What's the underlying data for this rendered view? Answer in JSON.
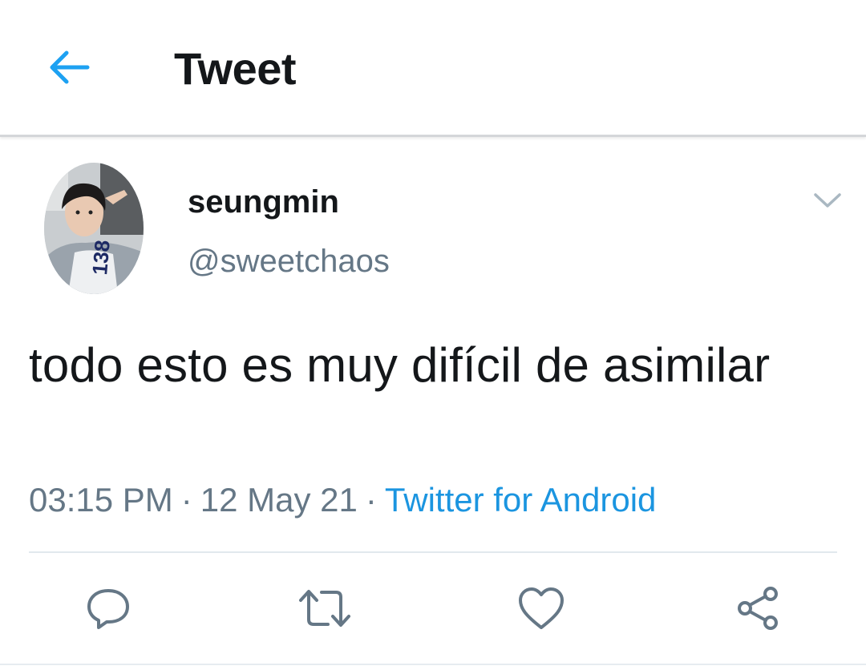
{
  "header": {
    "back_icon": "arrow-left-icon",
    "title": "Tweet",
    "accent_color": "#1da1f2"
  },
  "tweet": {
    "author_name": "seungmin",
    "author_handle": "@sweetchaos",
    "text": "todo esto es muy difícil de asimilar",
    "time": "03:15 PM",
    "separator": "·",
    "date": "12 May 21",
    "source": "Twitter for Android",
    "source_color": "#1b95e0",
    "menu_icon": "chevron-down-icon"
  },
  "actions": [
    {
      "name": "reply",
      "icon": "reply-icon"
    },
    {
      "name": "retweet",
      "icon": "retweet-icon"
    },
    {
      "name": "like",
      "icon": "heart-icon"
    },
    {
      "name": "share",
      "icon": "share-icon"
    }
  ]
}
